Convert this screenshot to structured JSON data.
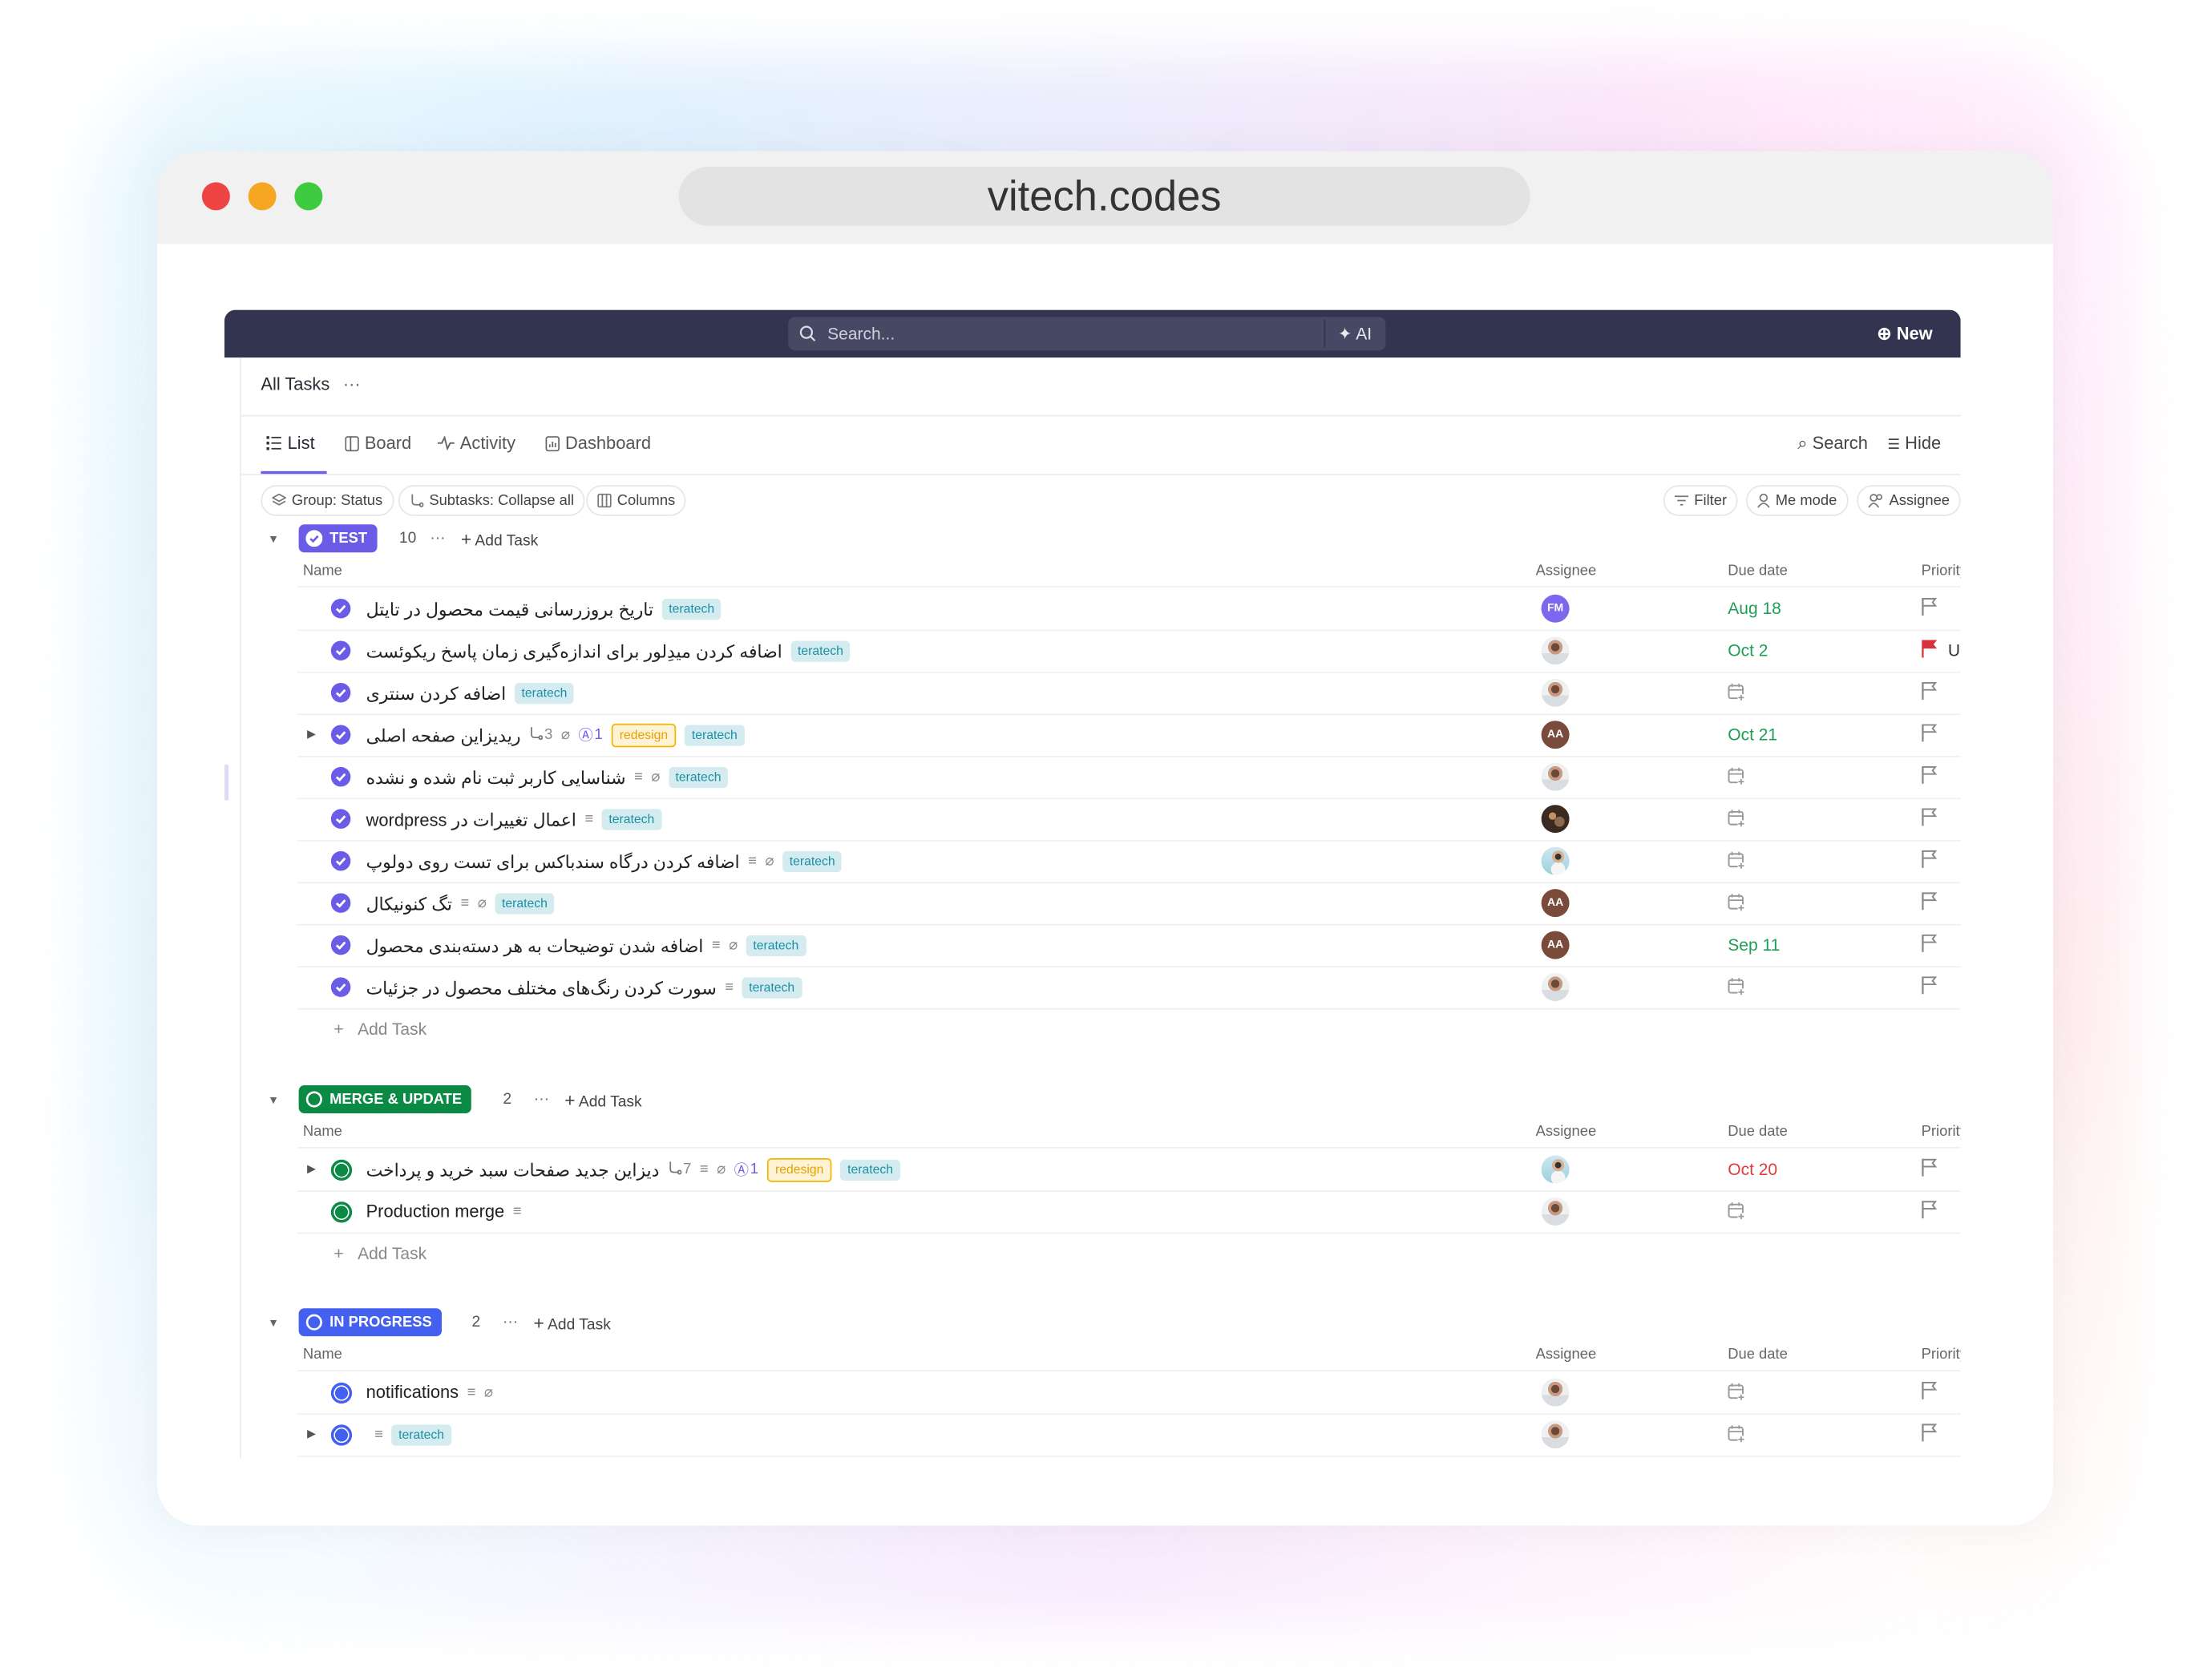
{
  "browser": {
    "url": "vitech.codes",
    "lights": [
      "#ee4444",
      "#f5a623",
      "#3fcb3f"
    ]
  },
  "topbar": {
    "search_placeholder": "Search...",
    "ai_label": "AI",
    "new_label": "New"
  },
  "page": {
    "title": "All Tasks",
    "more": "···"
  },
  "tabs": [
    {
      "label": "List",
      "icon": "list-icon",
      "active": true
    },
    {
      "label": "Board",
      "icon": "board-icon"
    },
    {
      "label": "Activity",
      "icon": "activity-icon"
    },
    {
      "label": "Dashboard",
      "icon": "dashboard-icon"
    }
  ],
  "toolbar_right": {
    "search": "Search",
    "hide": "Hide"
  },
  "chips_left": [
    {
      "label": "Group: Status",
      "icon": "layers-icon"
    },
    {
      "label": "Subtasks: Collapse all",
      "icon": "subtask-icon"
    },
    {
      "label": "Columns",
      "icon": "columns-icon"
    }
  ],
  "chips_right": [
    {
      "label": "Filter",
      "icon": "filter-icon"
    },
    {
      "label": "Me mode",
      "icon": "user-icon"
    },
    {
      "label": "Assignee",
      "icon": "users-icon"
    }
  ],
  "columns": {
    "name": "Name",
    "assignee": "Assignee",
    "due": "Due date",
    "priority": "Priority"
  },
  "add_task": "Add Task",
  "colors": {
    "accent": "#6b5ce7",
    "due_green": "#1f9d55",
    "due_red": "#e03b3b",
    "urgent": "#d9323c"
  },
  "groups": [
    {
      "name": "TEST",
      "color": "#6b5ce7",
      "count": "10",
      "icon": "check-circle",
      "rows": [
        {
          "title": "تاریخ بروزرسانی قیمت محصول در تایتل",
          "tags": [
            "teratech"
          ],
          "assignee": {
            "type": "initials",
            "text": "FM",
            "color": "#7b68ee"
          },
          "due": "Aug 18",
          "due_color": "green"
        },
        {
          "title": "اضافه کردن میدِلور برای اندازه‌گیری زمان پاسخ ریکوئست",
          "tags": [
            "teratech"
          ],
          "assignee": {
            "type": "photo",
            "variant": "a"
          },
          "due": "Oct 2",
          "due_color": "green",
          "priority": "Urgent"
        },
        {
          "title": "اضافه کردن سنتری",
          "tags": [
            "teratech"
          ],
          "assignee": {
            "type": "photo",
            "variant": "a"
          }
        },
        {
          "title": "ریدیزاین صفحه اصلی",
          "expandable": true,
          "subtasks": "3",
          "attachment": true,
          "mentions": "1",
          "tags": [
            "redesign",
            "teratech"
          ],
          "assignee": {
            "type": "initials",
            "text": "AA",
            "color": "#7a4a3a"
          },
          "due": "Oct 21",
          "due_color": "green"
        },
        {
          "title": "شناسایی کاربر ثبت نام شده و نشده",
          "description": true,
          "attachment": true,
          "tags": [
            "teratech"
          ],
          "assignee": {
            "type": "photo",
            "variant": "a"
          }
        },
        {
          "title": "اعمال تغییرات در wordpress",
          "description": true,
          "tags": [
            "teratech"
          ],
          "assignee": {
            "type": "photo",
            "variant": "b"
          }
        },
        {
          "title": "اضافه کردن درگاه سندباکس برای تست روی دولوپ",
          "description": true,
          "attachment": true,
          "tags": [
            "teratech"
          ],
          "assignee": {
            "type": "photo",
            "variant": "c"
          }
        },
        {
          "title": "تگ کنونیکال",
          "description": true,
          "attachment": true,
          "tags": [
            "teratech"
          ],
          "assignee": {
            "type": "initials",
            "text": "AA",
            "color": "#7a4a3a"
          }
        },
        {
          "title": "اضافه شدن توضیحات به هر دسته‌بندی محصول",
          "description": true,
          "attachment": true,
          "tags": [
            "teratech"
          ],
          "assignee": {
            "type": "initials",
            "text": "AA",
            "color": "#7a4a3a"
          },
          "due": "Sep 11",
          "due_color": "green"
        },
        {
          "title": "سورت کردن رنگ‌های مختلف محصول در جزئیات",
          "description": true,
          "tags": [
            "teratech"
          ],
          "assignee": {
            "type": "photo",
            "variant": "a"
          }
        }
      ]
    },
    {
      "name": "MERGE & UPDATE",
      "color": "#0b8a45",
      "count": "2",
      "icon": "ring",
      "rows": [
        {
          "title": "دیزاین جدید صفحات سبد خرید و پرداخت",
          "expandable": true,
          "subtasks": "7",
          "description": true,
          "attachment": true,
          "mentions": "1",
          "tags": [
            "redesign",
            "teratech"
          ],
          "assignee": {
            "type": "photo",
            "variant": "c"
          },
          "due": "Oct 20",
          "due_color": "red"
        },
        {
          "title": "Production merge",
          "description": true,
          "tags": [],
          "assignee": {
            "type": "photo",
            "variant": "a"
          }
        }
      ]
    },
    {
      "name": "IN PROGRESS",
      "color": "#4460f0",
      "count": "2",
      "icon": "ring",
      "rows": [
        {
          "title": "notifications",
          "description": true,
          "attachment": true,
          "tags": [],
          "assignee": {
            "type": "photo",
            "variant": "a"
          }
        },
        {
          "title": "",
          "expandable": true,
          "description": true,
          "tags": [
            "teratech"
          ],
          "assignee": {
            "type": "photo",
            "variant": "a"
          }
        }
      ]
    }
  ]
}
